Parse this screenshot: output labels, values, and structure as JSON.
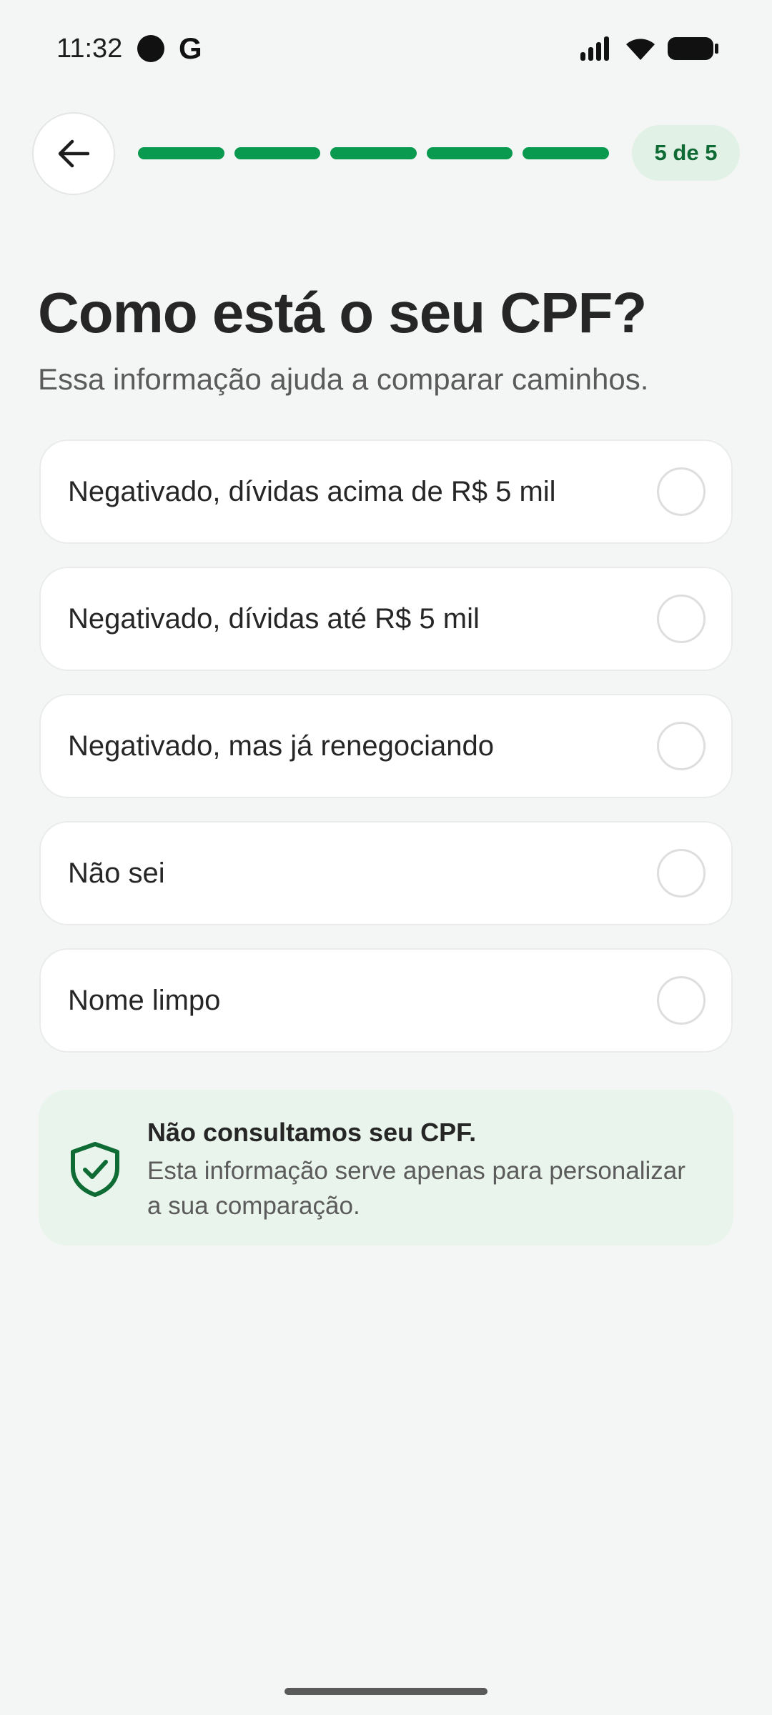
{
  "status_bar": {
    "time": "11:32",
    "app_icon_letter": "G"
  },
  "header": {
    "back_icon": "arrow-left-icon",
    "progress": {
      "current": 5,
      "total": 5
    },
    "step_label": "5 de 5"
  },
  "main": {
    "title": "Como está o seu CPF?",
    "subtitle": "Essa informação ajuda a comparar caminhos.",
    "options": [
      {
        "label": "Negativado, dívidas acima de R$ 5 mil",
        "selected": false
      },
      {
        "label": "Negativado, dívidas até R$ 5 mil",
        "selected": false
      },
      {
        "label": "Negativado, mas já renegociando",
        "selected": false
      },
      {
        "label": "Não sei",
        "selected": false
      },
      {
        "label": "Nome limpo",
        "selected": false
      }
    ]
  },
  "info_card": {
    "icon": "shield-check-icon",
    "title": "Não consultamos seu CPF.",
    "text": "Esta informação serve apenas para personalizar a sua comparação."
  },
  "colors": {
    "accent": "#0a9a4f",
    "badge_bg": "#e1f1e6",
    "badge_text": "#0f6b34",
    "info_bg": "#e9f4ec",
    "page_bg": "#f4f6f5"
  }
}
